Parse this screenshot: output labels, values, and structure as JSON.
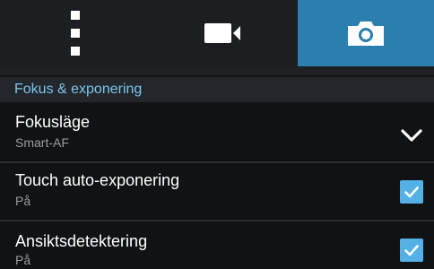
{
  "tabs": [
    {
      "name": "menu",
      "icon": "menu-dots-icon",
      "active": false
    },
    {
      "name": "video",
      "icon": "video-camera-icon",
      "active": false
    },
    {
      "name": "photo",
      "icon": "camera-icon",
      "active": true
    }
  ],
  "section": {
    "title": "Fokus & exponering"
  },
  "settings": [
    {
      "label": "Fokusläge",
      "value": "Smart-AF",
      "control": "dropdown",
      "icon": "chevron-down-icon"
    },
    {
      "label": "Touch auto-exponering",
      "value": "På",
      "control": "checkbox",
      "checked": true,
      "icon": "checkbox-checked-icon"
    },
    {
      "label": "Ansiktsdetektering",
      "value": "På",
      "control": "checkbox",
      "checked": true,
      "icon": "checkbox-checked-icon"
    }
  ],
  "colors": {
    "accent": "#2a7fae",
    "header_text": "#7cc6ee",
    "checkbox": "#54b1e6"
  }
}
